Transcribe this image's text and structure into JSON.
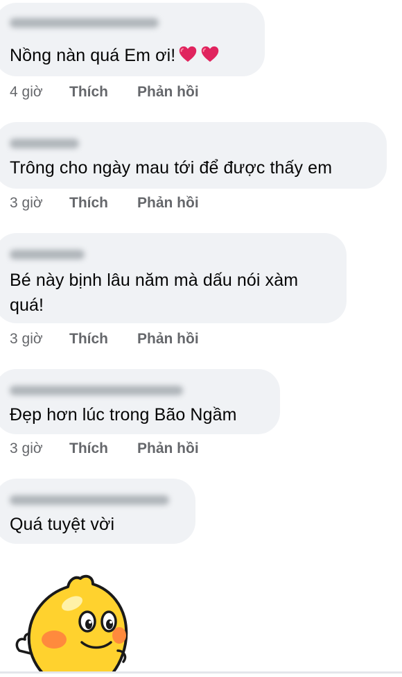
{
  "comments": [
    {
      "text": "Nồng nàn quá Em ơi!",
      "hearts": 2,
      "time": "4 giờ",
      "like_label": "Thích",
      "reply_label": "Phản hồi"
    },
    {
      "text": "Trông cho ngày mau tới để được thấy em",
      "time": "3 giờ",
      "like_label": "Thích",
      "reply_label": "Phản hồi"
    },
    {
      "text_line1": "Bé này bịnh lâu năm mà dấu nói xàm",
      "text_line2": "quá!",
      "time": "3 giờ",
      "like_label": "Thích",
      "reply_label": "Phản hồi"
    },
    {
      "text": "Đẹp hơn lúc trong Bão Ngầm",
      "time": "3 giờ",
      "like_label": "Thích",
      "reply_label": "Phản hồi"
    },
    {
      "text": "Quá tuyệt vời"
    }
  ],
  "sticker": {
    "icon": "yellow-chick-sticker-icon"
  },
  "colors": {
    "bubble": "#f0f2f5",
    "meta_text": "#65676b",
    "heart": "#e0245e"
  }
}
